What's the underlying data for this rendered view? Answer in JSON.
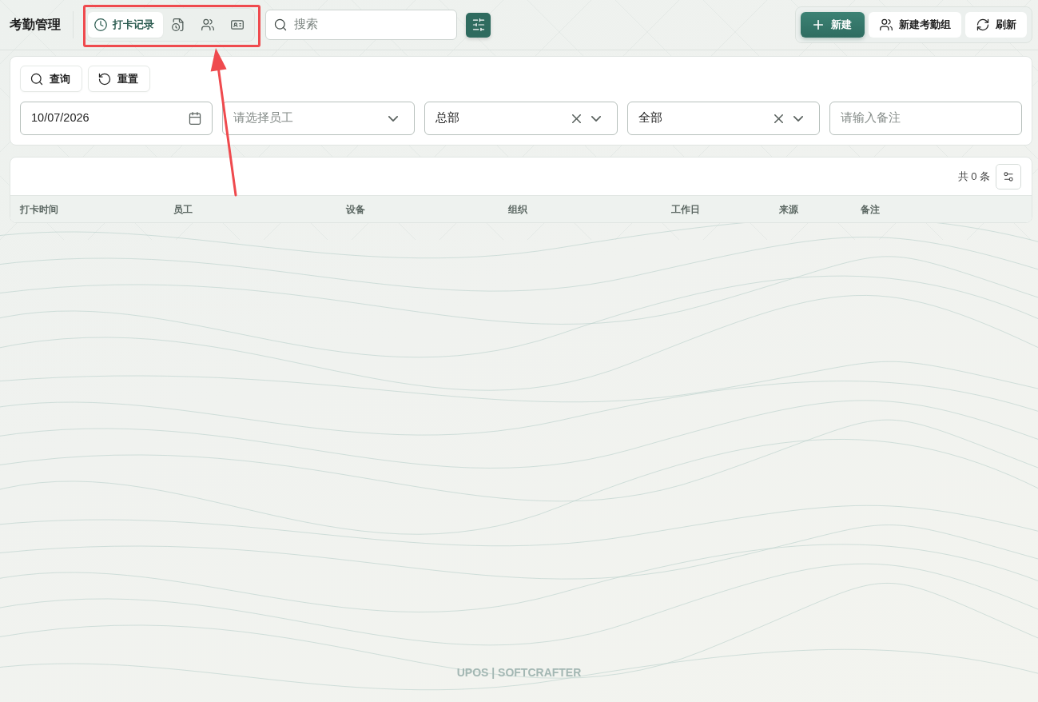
{
  "header": {
    "title": "考勤管理",
    "view_tabs": [
      {
        "kind": "clock",
        "label": "打卡记录",
        "selected": true
      },
      {
        "kind": "document-clock",
        "selected": false
      },
      {
        "kind": "users",
        "selected": false
      },
      {
        "kind": "id-card",
        "selected": false
      }
    ],
    "search": {
      "placeholder": "搜索"
    },
    "actions": [
      {
        "kind": "primary",
        "label": "新建"
      },
      {
        "kind": "secondary",
        "label": "新建考勤组"
      },
      {
        "kind": "secondary",
        "label": "刷新"
      }
    ]
  },
  "filters": {
    "buttons": [
      {
        "label": "查询"
      },
      {
        "label": "重置"
      }
    ],
    "fields": [
      {
        "kind": "date",
        "value": "10/07/2026"
      },
      {
        "kind": "select",
        "placeholder": "请选择员工",
        "clearable": false
      },
      {
        "kind": "select",
        "value": "总部",
        "clearable": true
      },
      {
        "kind": "select",
        "value": "全部",
        "clearable": true
      },
      {
        "kind": "text",
        "placeholder": "请输入备注"
      }
    ]
  },
  "table": {
    "total": "共 0 条",
    "columns": [
      "打卡时间",
      "员工",
      "设备",
      "组织",
      "工作日",
      "来源",
      "备注"
    ]
  },
  "footer": {
    "text": "UPOS | SOFTCRAFTER"
  },
  "annotation": {
    "frame": true,
    "arrow": true
  }
}
